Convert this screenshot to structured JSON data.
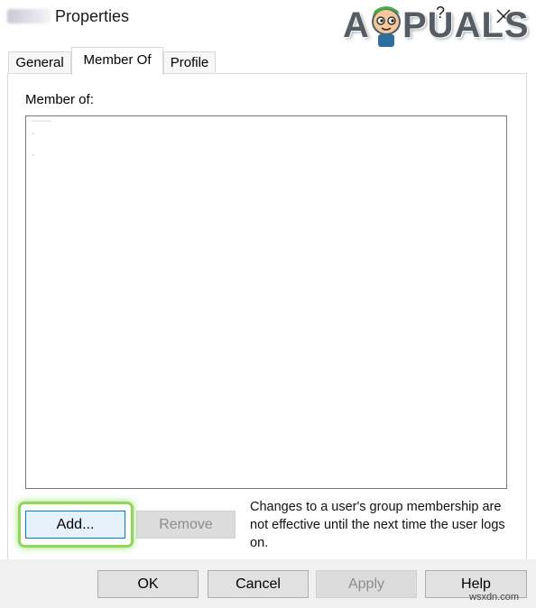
{
  "window": {
    "title": "Properties",
    "help_label": "?",
    "close_icon": "close-icon"
  },
  "logo": {
    "a": "A",
    "rest": "PUALS"
  },
  "tabs": [
    {
      "label": "General",
      "active": false
    },
    {
      "label": "Member Of",
      "active": true
    },
    {
      "label": "Profile",
      "active": false
    }
  ],
  "member_of": {
    "label": "Member of:",
    "items": []
  },
  "buttons": {
    "add": "Add...",
    "remove": "Remove",
    "ok": "OK",
    "cancel": "Cancel",
    "apply": "Apply",
    "help": "Help"
  },
  "note": "Changes to a user's group membership are not effective until the next time the user logs on.",
  "watermark": "wsxdn.com",
  "colors": {
    "highlight_glow": "#8fd65a",
    "focus_border": "#0078d7",
    "disabled_text": "#8d8d8d",
    "footer_bg": "#f0f0f0"
  }
}
